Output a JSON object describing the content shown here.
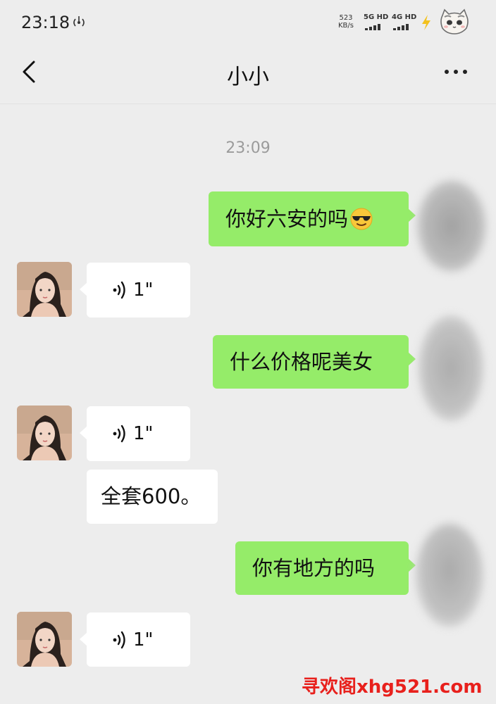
{
  "status_bar": {
    "time": "23:18",
    "speed_value": "523",
    "speed_unit": "KB/s",
    "network1": "5G HD",
    "network2": "4G HD"
  },
  "header": {
    "title": "小小",
    "accent_color": "#95ec69"
  },
  "chat": {
    "timestamp": "23:09",
    "messages": [
      {
        "side": "out",
        "type": "text",
        "text": "你好六安的吗",
        "emoji": "smiling-face-with-sunglasses-icon"
      },
      {
        "side": "in",
        "type": "voice",
        "duration": "1\""
      },
      {
        "side": "out",
        "type": "text",
        "text": "什么价格呢美女"
      },
      {
        "side": "in",
        "type": "voice",
        "duration": "1\""
      },
      {
        "side": "in",
        "type": "text",
        "text": "全套600。"
      },
      {
        "side": "out",
        "type": "text",
        "text": "你有地方的吗"
      },
      {
        "side": "in",
        "type": "voice",
        "duration": "1\""
      }
    ]
  },
  "watermark": "寻欢阁xhg521.com"
}
